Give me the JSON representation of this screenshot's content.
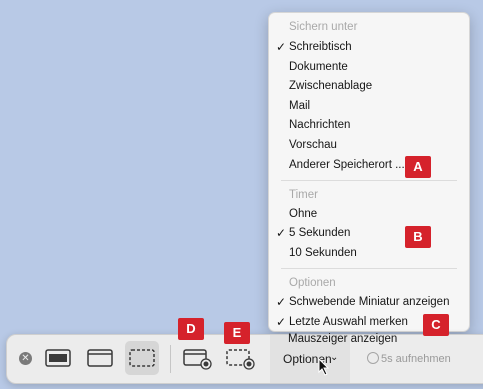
{
  "menu": {
    "sections": {
      "save_to": {
        "header": "Sichern unter",
        "items": [
          {
            "label": "Schreibtisch",
            "checked": true
          },
          {
            "label": "Dokumente",
            "checked": false
          },
          {
            "label": "Zwischenablage",
            "checked": false
          },
          {
            "label": "Mail",
            "checked": false
          },
          {
            "label": "Nachrichten",
            "checked": false
          },
          {
            "label": "Vorschau",
            "checked": false
          },
          {
            "label": "Anderer Speicherort ...",
            "checked": false
          }
        ]
      },
      "timer": {
        "header": "Timer",
        "items": [
          {
            "label": "Ohne",
            "checked": false
          },
          {
            "label": "5 Sekunden",
            "checked": true
          },
          {
            "label": "10 Sekunden",
            "checked": false
          }
        ]
      },
      "options": {
        "header": "Optionen",
        "items": [
          {
            "label": "Schwebende Miniatur anzeigen",
            "checked": true
          },
          {
            "label": "Letzte Auswahl merken",
            "checked": true
          },
          {
            "label": "Mauszeiger anzeigen",
            "checked": false
          }
        ]
      }
    },
    "check_glyph": "✓"
  },
  "toolbar": {
    "close_glyph": "✕",
    "options_label": "Optionen",
    "options_chevron": "⌄",
    "record_label": "5s aufnehmen"
  },
  "callouts": {
    "a": "A",
    "b": "B",
    "c": "C",
    "d": "D",
    "e": "E"
  },
  "colors": {
    "callout_red": "#d5222b",
    "desktop_blue": "#b8c9e6"
  }
}
